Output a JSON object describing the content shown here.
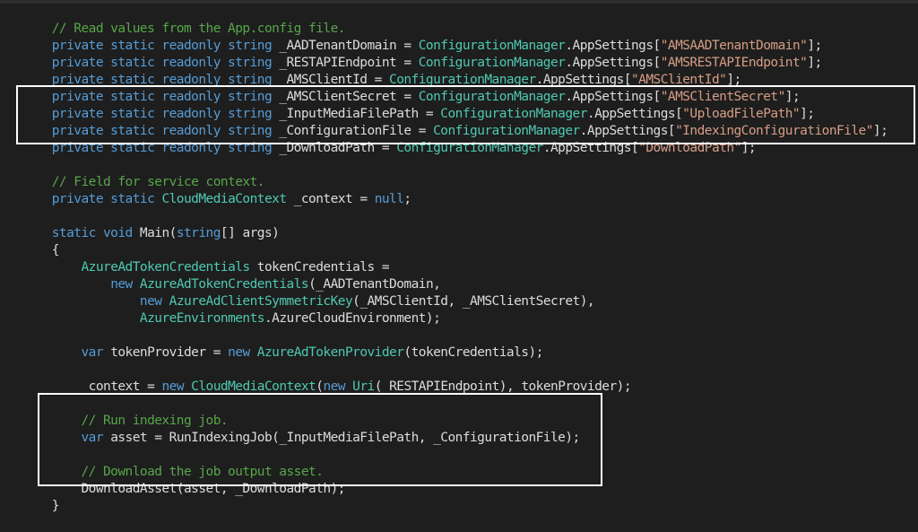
{
  "editor": {
    "comment_read_values": "// Read values from the App.config file.",
    "line_tenant": {
      "kw": "private static readonly string",
      "id": " _AADTenantDomain = ",
      "type": "ConfigurationManager",
      "mid": ".AppSettings[",
      "str": "\"AMSAADTenantDomain\"",
      "end": "];"
    },
    "line_restapi": {
      "kw": "private static readonly string",
      "id": " _RESTAPIEndpoint = ",
      "type": "ConfigurationManager",
      "mid": ".AppSettings[",
      "str": "\"AMSRESTAPIEndpoint\"",
      "end": "];"
    },
    "line_clientid": {
      "kw": "private static readonly string",
      "id": " _AMSClientId = ",
      "type": "ConfigurationManager",
      "mid": ".AppSettings[",
      "str": "\"AMSClientId\"",
      "end": "];"
    },
    "line_clientsecret": {
      "kw": "private static readonly string",
      "id": " _AMSClientSecret = ",
      "type": "ConfigurationManager",
      "mid": ".AppSettings[",
      "str": "\"AMSClientSecret\"",
      "end": "];"
    },
    "line_inputpath": {
      "kw": "private static readonly string",
      "id": " _InputMediaFilePath = ",
      "type": "ConfigurationManager",
      "mid": ".AppSettings[",
      "str": "\"UploadFilePath\"",
      "end": "];"
    },
    "line_configfile": {
      "kw": "private static readonly string",
      "id": " _ConfigurationFile = ",
      "type": "ConfigurationManager",
      "mid": ".AppSettings[",
      "str": "\"IndexingConfigurationFile\"",
      "end": "];"
    },
    "line_downloadpath": {
      "kw": "private static readonly string",
      "id": " _DownloadPath = ",
      "type": "ConfigurationManager",
      "mid": ".AppSettings[",
      "str": "\"DownloadPath\"",
      "end": "];"
    },
    "comment_field": "// Field for service context.",
    "line_context": {
      "kw": "private static",
      "type": " CloudMediaContext",
      "id": " _context = ",
      "kw2": "null",
      "end": ";"
    },
    "line_main": {
      "kw": "static void",
      "id": " Main(",
      "kw2": "string",
      "end": "[] args)"
    },
    "open_brace": "{",
    "line_tokencreds": {
      "indent": "    ",
      "type": "AzureAdTokenCredentials",
      "id": " tokenCredentials ="
    },
    "line_newcreds": {
      "indent": "        ",
      "kw": "new",
      "type": " AzureAdTokenCredentials",
      "id": "(_AADTenantDomain,"
    },
    "line_newkey": {
      "indent": "            ",
      "kw": "new",
      "type": " AzureAdClientSymmetricKey",
      "id": "(_AMSClientId, _AMSClientSecret),"
    },
    "line_env": {
      "indent": "            ",
      "type": "AzureEnvironments",
      "id": ".AzureCloudEnvironment);"
    },
    "line_provider": {
      "indent": "    ",
      "kw": "var",
      "id": " tokenProvider = ",
      "kw2": "new",
      "type": " AzureAdTokenProvider",
      "end": "(tokenCredentials);"
    },
    "line_newcontext": {
      "indent": "    ",
      "id": "_context = ",
      "kw": "new",
      "type": " CloudMediaContext",
      "mid": "(",
      "kw2": "new",
      "type2": " Uri",
      "end": "(_RESTAPIEndpoint), tokenProvider);"
    },
    "comment_run": "    // Run indexing job.",
    "line_asset": {
      "indent": "    ",
      "kw": "var",
      "id": " asset = RunIndexingJob(_InputMediaFilePath, _ConfigurationFile);"
    },
    "comment_download": "    // Download the job output asset.",
    "line_download": "    DownloadAsset(asset, _DownloadPath);",
    "close_brace": "}"
  },
  "colors": {
    "background": "#1e1e1e",
    "keyword": "#569cd6",
    "comment": "#57a64a",
    "string": "#d69d85",
    "type": "#4ec9b0",
    "identifier": "#dcdcdc",
    "highlight_box": "#ffffff"
  }
}
